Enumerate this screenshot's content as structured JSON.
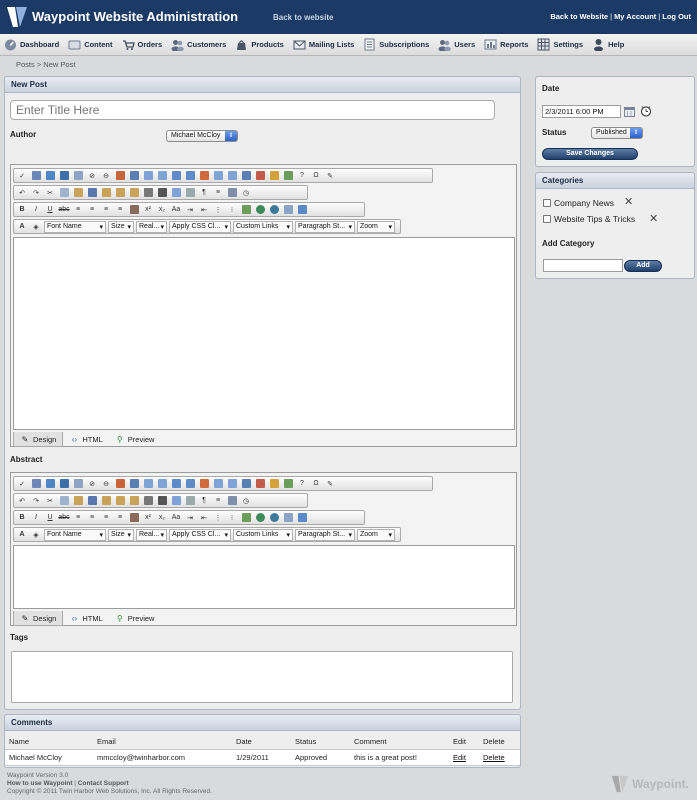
{
  "header": {
    "app_title": "Waypoint Website Administration",
    "back_link": "Back to website",
    "account_links": [
      "Back to Website",
      "My Account",
      "Log Out"
    ]
  },
  "nav": [
    {
      "label": "Dashboard",
      "icon": "dashboard-icon"
    },
    {
      "label": "Content",
      "icon": "content-icon"
    },
    {
      "label": "Orders",
      "icon": "orders-icon"
    },
    {
      "label": "Customers",
      "icon": "customers-icon"
    },
    {
      "label": "Products",
      "icon": "products-icon"
    },
    {
      "label": "Mailing Lists",
      "icon": "mailing-lists-icon"
    },
    {
      "label": "Subscriptions",
      "icon": "subscriptions-icon"
    },
    {
      "label": "Users",
      "icon": "users-icon"
    },
    {
      "label": "Reports",
      "icon": "reports-icon"
    },
    {
      "label": "Settings",
      "icon": "settings-icon"
    },
    {
      "label": "Help",
      "icon": "help-icon"
    }
  ],
  "breadcrumb": "Posts > New Post",
  "post": {
    "panel_title": "New Post",
    "title_placeholder": "Enter Title Here",
    "author_label": "Author",
    "author_value": "Michael McCloy",
    "abstract_label": "Abstract",
    "tags_label": "Tags"
  },
  "editor": {
    "dropdowns": [
      "Font Name",
      "Size",
      "Real...",
      "Apply CSS Cl...",
      "Custom Links",
      "Paragraph St...",
      "Zoom"
    ],
    "modes": [
      "Design",
      "HTML",
      "Preview"
    ]
  },
  "sidebar": {
    "date_label": "Date",
    "date_value": "2/3/2011 6:00 PM",
    "status_label": "Status",
    "status_value": "Published",
    "save_button": "Save Changes",
    "categories_title": "Categories",
    "categories": [
      "Company News",
      "Website Tips & Tricks"
    ],
    "add_category_label": "Add Category",
    "add_button": "Add"
  },
  "comments": {
    "title": "Comments",
    "columns": [
      "Name",
      "Email",
      "Date",
      "Status",
      "Comment",
      "Edit",
      "Delete"
    ],
    "rows": [
      {
        "name": "Michael McCloy",
        "email": "mmccloy@twinharbor.com",
        "date": "1/29/2011",
        "status": "Approved",
        "comment": "this is a great post!",
        "edit": "Edit",
        "delete": "Delete"
      }
    ]
  },
  "footer": {
    "version": "Waypoint Version 3.0",
    "help_link": "How to use Waypoint",
    "support_link": "Contact Support",
    "copyright": "Copyright © 2011 Twin Harbor Web Solutions, Inc. All Rights Reserved.",
    "logo_text": "Waypoint."
  },
  "colors": {
    "header_bg": "#1b3a66",
    "accent_blue": "#2c61c7",
    "button_dark": "#20406b"
  }
}
